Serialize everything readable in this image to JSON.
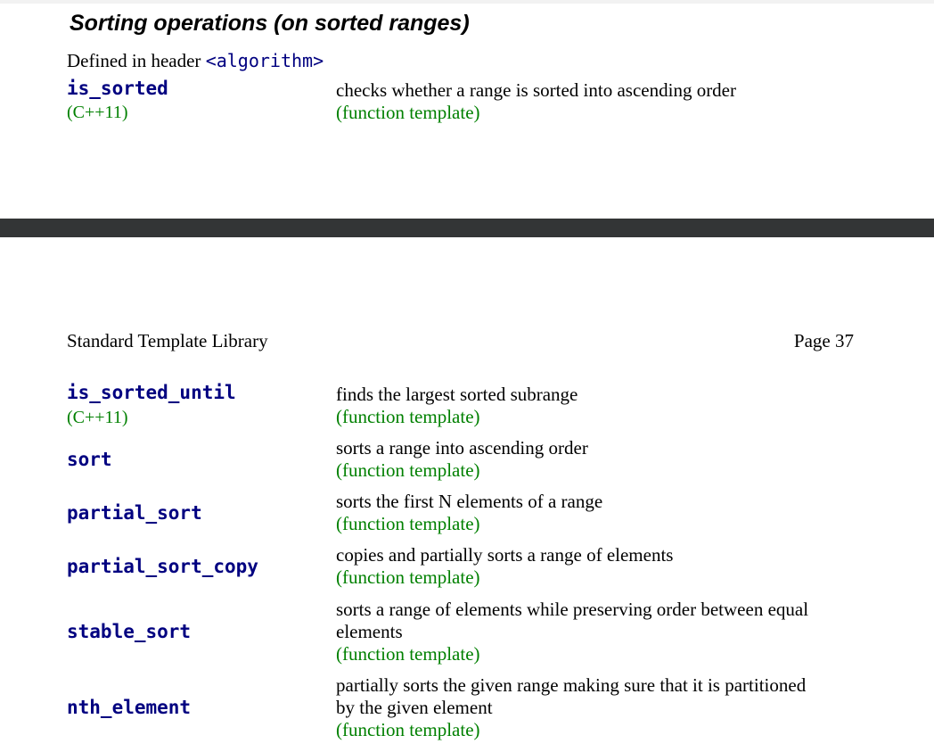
{
  "section": {
    "title": "Sorting operations (on sorted ranges)",
    "defined_prefix": "Defined in header",
    "header_file": "<algorithm>"
  },
  "running_header": {
    "left": "Standard Template Library",
    "right": "Page 37"
  },
  "functions": [
    {
      "name": "is_sorted",
      "standard": "(C++11)",
      "description": [
        "checks whether a range is sorted into ascending order"
      ],
      "kind": "(function template)"
    },
    {
      "name": "is_sorted_until",
      "standard": "(C++11)",
      "description": [
        "finds the largest sorted subrange"
      ],
      "kind": "(function template)"
    },
    {
      "name": "sort",
      "standard": "",
      "description": [
        "sorts a range into ascending order"
      ],
      "kind": "(function template)"
    },
    {
      "name": "partial_sort",
      "standard": "",
      "description": [
        "sorts the first N elements of a range"
      ],
      "kind": "(function template)"
    },
    {
      "name": "partial_sort_copy",
      "standard": "",
      "description": [
        "copies and partially sorts a range of elements"
      ],
      "kind": "(function template)"
    },
    {
      "name": "stable_sort",
      "standard": "",
      "description": [
        "sorts a range of elements while preserving order between equal",
        "elements"
      ],
      "kind": "(function template)"
    },
    {
      "name": "nth_element",
      "standard": "",
      "description": [
        "partially sorts the given range making sure that it is partitioned",
        "by the given element"
      ],
      "kind": "(function template)"
    }
  ],
  "colors": {
    "function_name": "#000080",
    "annotation": "#008000",
    "page_gap": "#333536"
  }
}
